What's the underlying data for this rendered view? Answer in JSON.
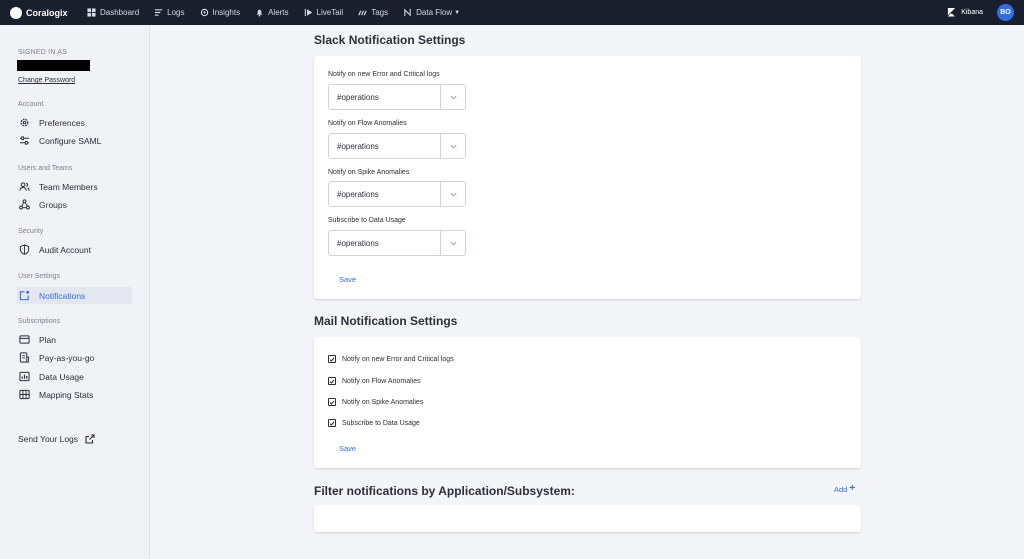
{
  "topbar": {
    "brand": "Coralogix",
    "nav": [
      {
        "label": "Dashboard",
        "icon": "dashboard-icon"
      },
      {
        "label": "Logs",
        "icon": "logs-icon"
      },
      {
        "label": "Insights",
        "icon": "insights-icon"
      },
      {
        "label": "Alerts",
        "icon": "bell-icon"
      },
      {
        "label": "LiveTail",
        "icon": "livetail-icon"
      },
      {
        "label": "Tags",
        "icon": "tags-icon"
      },
      {
        "label": "Data Flow",
        "icon": "dataflow-icon",
        "dropdown": true
      }
    ],
    "kibana": "Kibana",
    "avatar": "BO"
  },
  "sidebar": {
    "signed_in_label": "SIGNED IN AS",
    "change_password": "Change Password",
    "sections": [
      {
        "label": "Account",
        "items": [
          {
            "label": "Preferences",
            "icon": "gear-icon"
          },
          {
            "label": "Configure SAML",
            "icon": "sliders-icon"
          }
        ]
      },
      {
        "label": "Users and Teams",
        "items": [
          {
            "label": "Team Members",
            "icon": "users-icon"
          },
          {
            "label": "Groups",
            "icon": "groups-icon"
          }
        ]
      },
      {
        "label": "Security",
        "items": [
          {
            "label": "Audit Account",
            "icon": "shield-icon"
          }
        ]
      },
      {
        "label": "User Settings",
        "items": [
          {
            "label": "Notifications",
            "icon": "notification-icon",
            "active": true
          }
        ]
      },
      {
        "label": "Subscriptions",
        "items": [
          {
            "label": "Plan",
            "icon": "plan-icon"
          },
          {
            "label": "Pay-as-you-go",
            "icon": "invoice-icon"
          },
          {
            "label": "Data Usage",
            "icon": "chart-icon"
          },
          {
            "label": "Mapping Stats",
            "icon": "map-icon"
          }
        ]
      }
    ],
    "send_logs": "Send Your Logs"
  },
  "slack": {
    "title": "Slack Notification Settings",
    "fields": [
      {
        "label": "Notify on new Error and Critical logs",
        "value": "#operations"
      },
      {
        "label": "Notify on Flow Anomalies",
        "value": "#operations"
      },
      {
        "label": "Notify on Spike Anomalies",
        "value": "#operations"
      },
      {
        "label": "Subscribe to Data Usage",
        "value": "#operations"
      }
    ],
    "save": "Save"
  },
  "mail": {
    "title": "Mail Notification Settings",
    "options": [
      {
        "label": "Notify on new Error and Critical logs",
        "checked": true
      },
      {
        "label": "Notify on Flow Anomalies",
        "checked": true
      },
      {
        "label": "Notify on Spike Anomalies",
        "checked": true
      },
      {
        "label": "Subscribe to Data Usage",
        "checked": true
      }
    ],
    "save": "Save"
  },
  "filter": {
    "title": "Filter notifications by Application/Subsystem:",
    "add": "Add"
  },
  "colors": {
    "topbar": "#1a1f2e",
    "accent": "#2f6fe0",
    "sidebar_bg": "#f1f2f6"
  }
}
